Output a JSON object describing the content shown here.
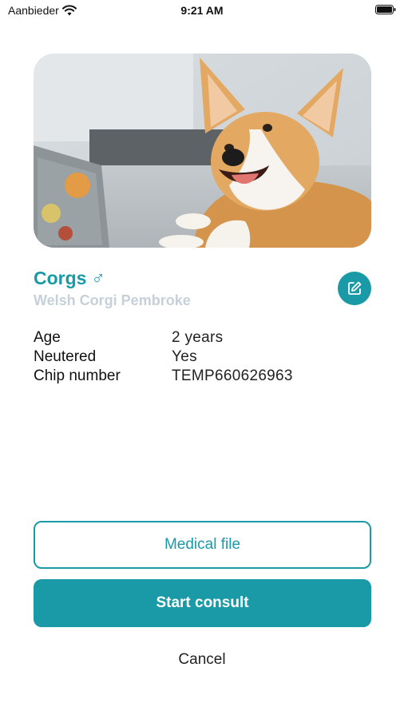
{
  "status_bar": {
    "carrier": "Aanbieder",
    "time": "9:21 AM"
  },
  "pet": {
    "name": "Corgs",
    "gender_symbol": "♂",
    "breed": "Welsh Corgi Pembroke"
  },
  "details": [
    {
      "label": "Age",
      "value": "2 years"
    },
    {
      "label": "Neutered",
      "value": "Yes"
    },
    {
      "label": "Chip number",
      "value": "TEMP660626963"
    }
  ],
  "actions": {
    "medical_file_label": "Medical file",
    "start_consult_label": "Start consult",
    "cancel_label": "Cancel"
  },
  "icons": {
    "wifi": "wifi-icon",
    "battery": "battery-icon",
    "edit": "edit-icon"
  },
  "colors": {
    "accent": "#1a9aa6",
    "breed_text": "#c6d0db"
  }
}
